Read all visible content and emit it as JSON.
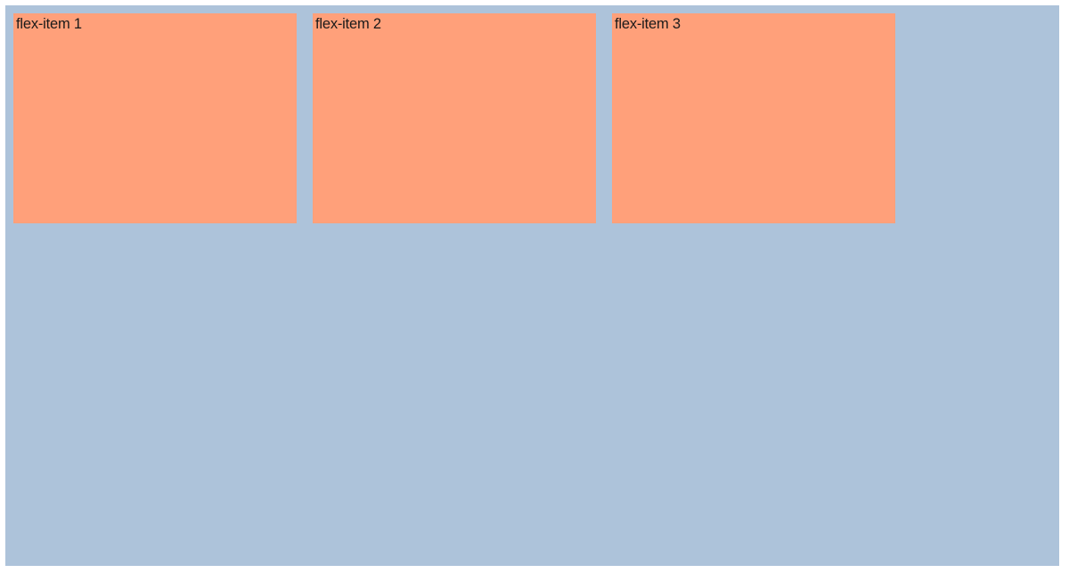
{
  "flex_items": [
    {
      "label": "flex-item 1"
    },
    {
      "label": "flex-item 2"
    },
    {
      "label": "flex-item 3"
    }
  ],
  "colors": {
    "container_bg": "#adc3da",
    "item_bg": "#ffa07a"
  }
}
